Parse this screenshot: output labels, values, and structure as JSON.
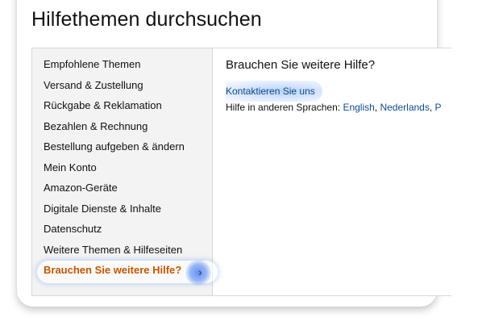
{
  "header": {
    "title": "Hilfethemen durchsuchen"
  },
  "sidebar": {
    "items": [
      {
        "label": "Empfohlene Themen"
      },
      {
        "label": "Versand & Zustellung"
      },
      {
        "label": "Rückgabe & Reklamation"
      },
      {
        "label": "Bezahlen & Rechnung"
      },
      {
        "label": "Bestellung aufgeben & ändern"
      },
      {
        "label": "Mein Konto"
      },
      {
        "label": "Amazon-Geräte"
      },
      {
        "label": "Digitale Dienste & Inhalte"
      },
      {
        "label": "Datenschutz"
      },
      {
        "label": "Weitere Themen & Hilfeseiten"
      },
      {
        "label": "Brauchen Sie weitere Hilfe?"
      }
    ],
    "active_chevron": "›",
    "active_color": "#c45500"
  },
  "content": {
    "heading": "Brauchen Sie weitere Hilfe?",
    "contact_link": "Kontaktieren Sie uns",
    "language_prefix": "Hilfe in anderen Sprachen:",
    "languages": [
      "English",
      "Nederlands",
      "P"
    ],
    "separator": ", "
  },
  "colors": {
    "link": "#0f4a8a",
    "sidebar_bg": "#f3f3f3",
    "highlight": "#5a8cf5"
  }
}
